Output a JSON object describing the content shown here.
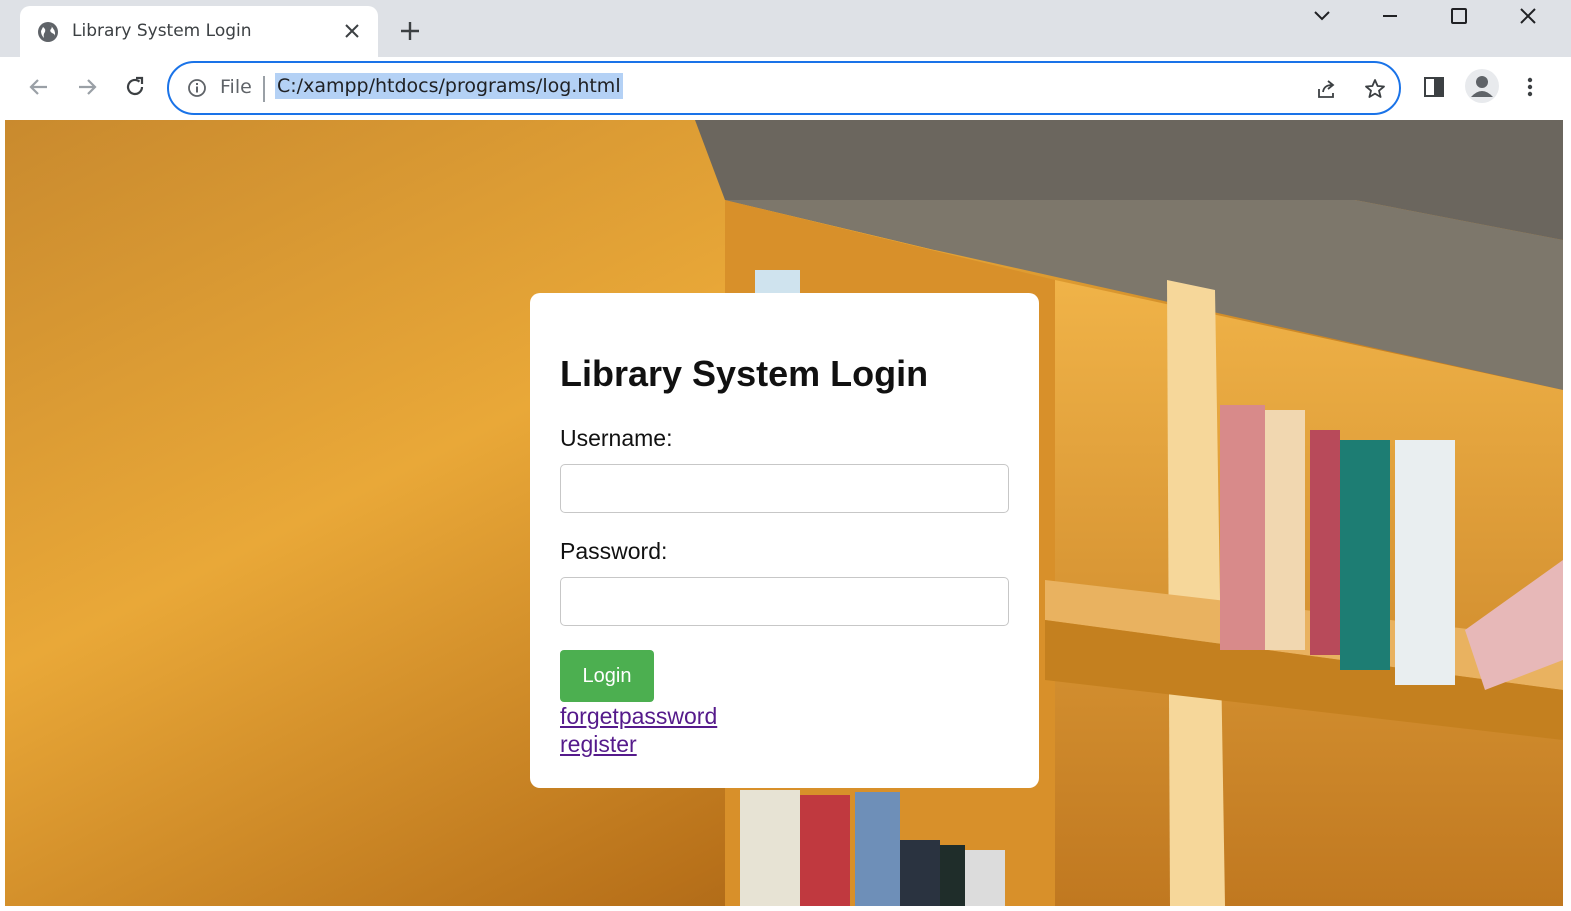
{
  "browser": {
    "tab_title": "Library System Login",
    "omnibox_scheme": "File",
    "url": "C:/xampp/htdocs/programs/log.html",
    "accent": "#1a73e8",
    "icons": [
      "globe-icon",
      "close-icon",
      "plus-icon",
      "chevron-down-icon",
      "minimize-icon",
      "maximize-icon",
      "window-close-icon",
      "back-icon",
      "forward-icon",
      "reload-icon",
      "info-icon",
      "share-icon",
      "star-icon",
      "side-panel-icon",
      "profile-icon",
      "menu-icon"
    ]
  },
  "login": {
    "title": "Library System Login",
    "username_label": "Username:",
    "username_value": "",
    "password_label": "Password:",
    "password_value": "",
    "login_button": "Login",
    "button_color": "#4caf50",
    "forgot_link": "forgetpassword",
    "register_link": "register",
    "link_color": "#551a8b"
  }
}
